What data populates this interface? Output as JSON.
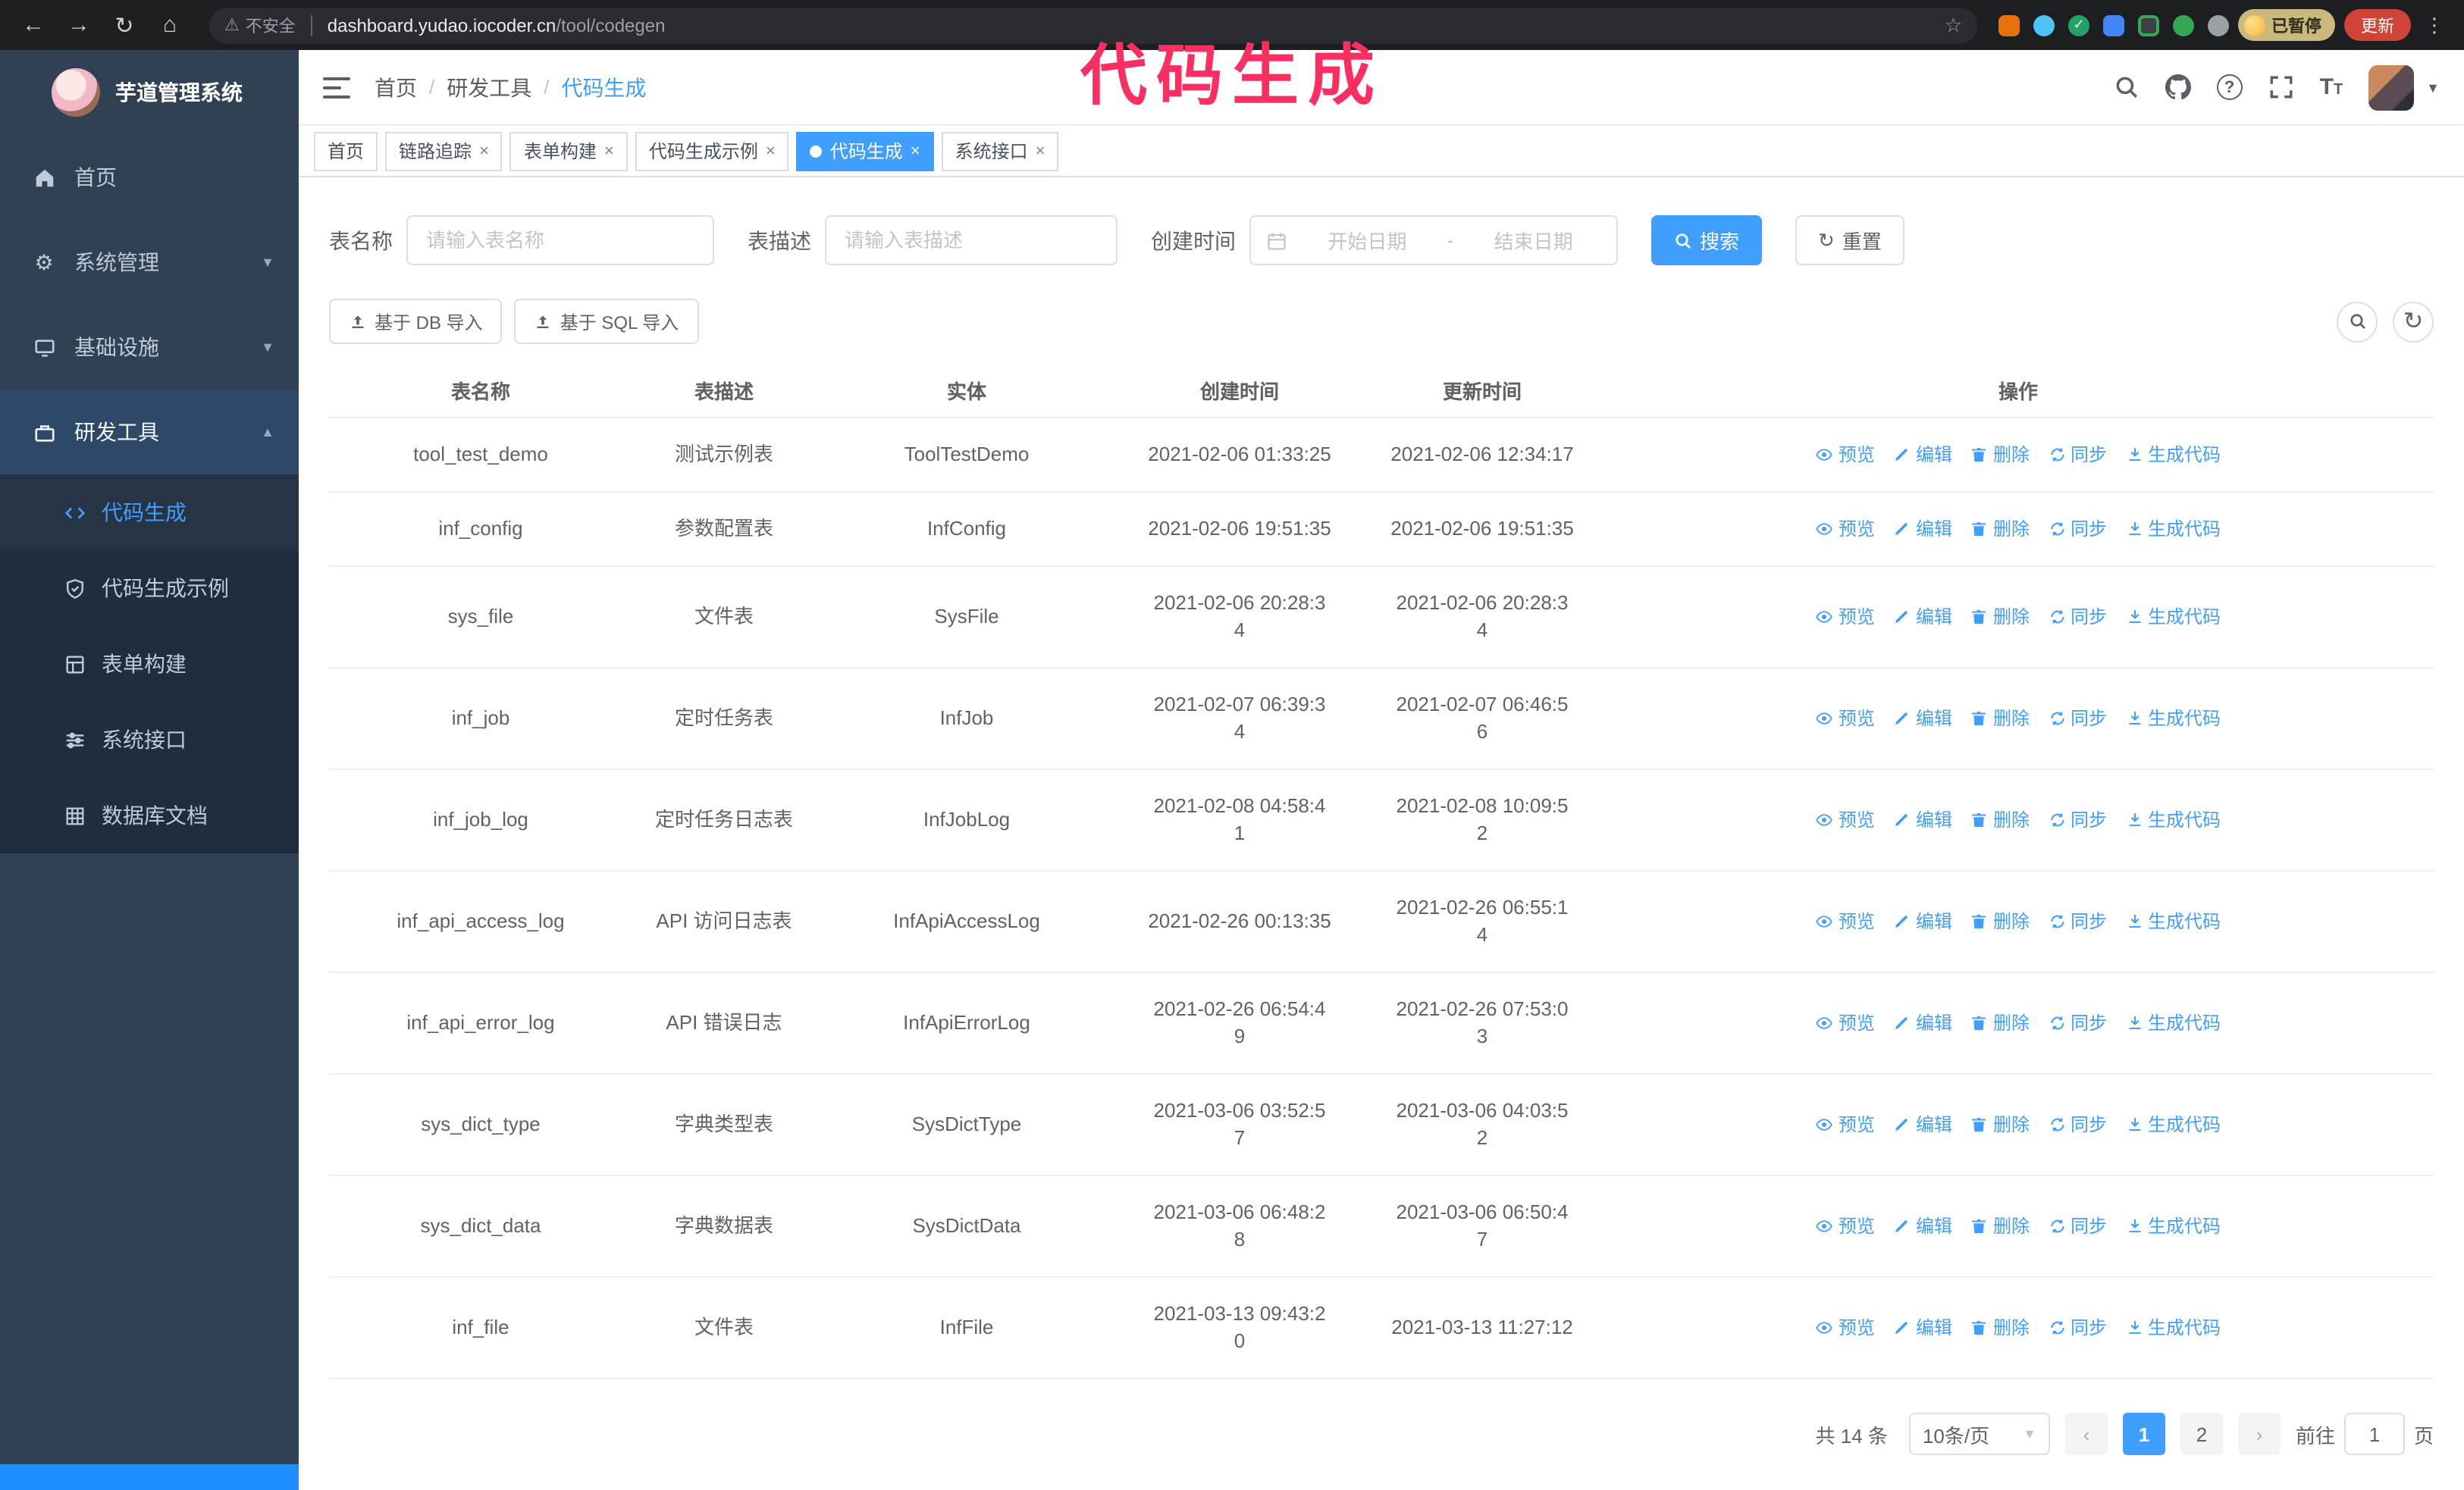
{
  "browser": {
    "security_label": "不安全",
    "url_host": "dashboard.yudao.iocoder.cn",
    "url_path": "/tool/codegen",
    "paused_badge": "已暂停",
    "update_button": "更新"
  },
  "annotation": {
    "text": "代码生成",
    "color": "#fb2e62"
  },
  "sidebar": {
    "logo_title": "芋道管理系统",
    "items": [
      {
        "label": "首页"
      },
      {
        "label": "系统管理"
      },
      {
        "label": "基础设施"
      },
      {
        "label": "研发工具",
        "expanded": true,
        "children": [
          {
            "label": "代码生成",
            "active": true
          },
          {
            "label": "代码生成示例"
          },
          {
            "label": "表单构建"
          },
          {
            "label": "系统接口"
          },
          {
            "label": "数据库文档"
          }
        ]
      }
    ]
  },
  "header": {
    "breadcrumb": [
      "首页",
      "研发工具",
      "代码生成"
    ]
  },
  "tabs": [
    {
      "label": "首页",
      "closable": false,
      "active": false
    },
    {
      "label": "链路追踪",
      "closable": true,
      "active": false
    },
    {
      "label": "表单构建",
      "closable": true,
      "active": false
    },
    {
      "label": "代码生成示例",
      "closable": true,
      "active": false
    },
    {
      "label": "代码生成",
      "closable": true,
      "active": true
    },
    {
      "label": "系统接口",
      "closable": true,
      "active": false
    }
  ],
  "filters": {
    "table_name_label": "表名称",
    "table_name_placeholder": "请输入表名称",
    "table_desc_label": "表描述",
    "table_desc_placeholder": "请输入表描述",
    "create_time_label": "创建时间",
    "date_start_placeholder": "开始日期",
    "date_separator": "-",
    "date_end_placeholder": "结束日期",
    "search_button": "搜索",
    "reset_button": "重置"
  },
  "toolbar": {
    "import_db_button": "基于 DB 导入",
    "import_sql_button": "基于 SQL 导入"
  },
  "table": {
    "columns": [
      "表名称",
      "表描述",
      "实体",
      "创建时间",
      "更新时间",
      "操作"
    ],
    "op_labels": [
      "预览",
      "编辑",
      "删除",
      "同步",
      "生成代码"
    ],
    "rows": [
      {
        "name": "tool_test_demo",
        "desc": "测试示例表",
        "entity": "ToolTestDemo",
        "created": "2021-02-06 01:33:25",
        "updated": "2021-02-06 12:34:17"
      },
      {
        "name": "inf_config",
        "desc": "参数配置表",
        "entity": "InfConfig",
        "created": "2021-02-06 19:51:35",
        "updated": "2021-02-06 19:51:35"
      },
      {
        "name": "sys_file",
        "desc": "文件表",
        "entity": "SysFile",
        "created": "2021-02-06 20:28:3\n4",
        "updated": "2021-02-06 20:28:3\n4"
      },
      {
        "name": "inf_job",
        "desc": "定时任务表",
        "entity": "InfJob",
        "created": "2021-02-07 06:39:3\n4",
        "updated": "2021-02-07 06:46:5\n6"
      },
      {
        "name": "inf_job_log",
        "desc": "定时任务日志表",
        "entity": "InfJobLog",
        "created": "2021-02-08 04:58:4\n1",
        "updated": "2021-02-08 10:09:5\n2"
      },
      {
        "name": "inf_api_access_log",
        "desc": "API 访问日志表",
        "entity": "InfApiAccessLog",
        "created": "2021-02-26 00:13:35",
        "updated": "2021-02-26 06:55:1\n4"
      },
      {
        "name": "inf_api_error_log",
        "desc": "API 错误日志",
        "entity": "InfApiErrorLog",
        "created": "2021-02-26 06:54:4\n9",
        "updated": "2021-02-26 07:53:0\n3"
      },
      {
        "name": "sys_dict_type",
        "desc": "字典类型表",
        "entity": "SysDictType",
        "created": "2021-03-06 03:52:5\n7",
        "updated": "2021-03-06 04:03:5\n2"
      },
      {
        "name": "sys_dict_data",
        "desc": "字典数据表",
        "entity": "SysDictData",
        "created": "2021-03-06 06:48:2\n8",
        "updated": "2021-03-06 06:50:4\n7"
      },
      {
        "name": "inf_file",
        "desc": "文件表",
        "entity": "InfFile",
        "created": "2021-03-13 09:43:2\n0",
        "updated": "2021-03-13 11:27:12"
      }
    ]
  },
  "pagination": {
    "total_text": "共 14 条",
    "page_size": "10条/页",
    "pages": [
      "1",
      "2"
    ],
    "active_page": "1",
    "goto_label": "前往",
    "goto_value": "1",
    "goto_suffix": "页"
  }
}
